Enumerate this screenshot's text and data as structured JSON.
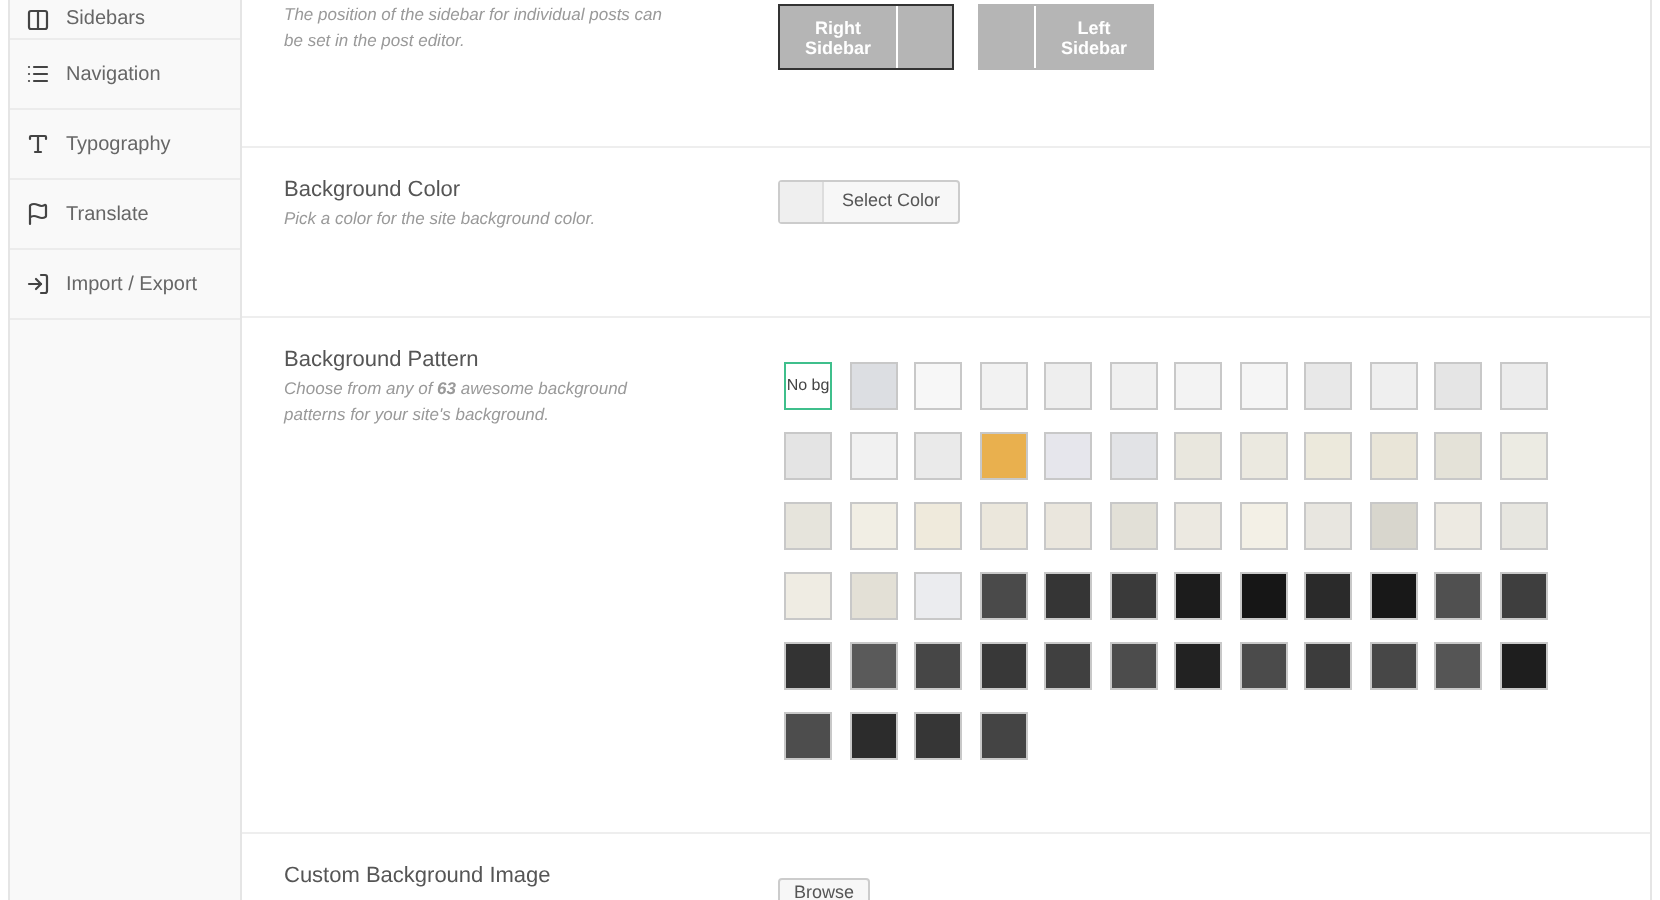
{
  "sidebar": {
    "items": [
      {
        "label": "Sidebars"
      },
      {
        "label": "Navigation"
      },
      {
        "label": "Typography"
      },
      {
        "label": "Translate"
      },
      {
        "label": "Import / Export"
      }
    ]
  },
  "sections": [
    {
      "kind": "layout",
      "description": "The position of the sidebar for individual posts can be set in the post editor.",
      "options": [
        {
          "kind": "right",
          "label": "Right Sidebar",
          "selected": true
        },
        {
          "kind": "left",
          "label": "Left Sidebar",
          "selected": false
        }
      ]
    },
    {
      "kind": "color",
      "title": "Background Color",
      "description": "Pick a color for the site background color.",
      "button": "Select Color"
    },
    {
      "kind": "patterns",
      "title": "Background Pattern",
      "description": "Choose from any of **63** awesome background patterns for your site's background.",
      "patterns": [
        {
          "kind": "none",
          "label": "No bg",
          "selected": true
        },
        {
          "kind": "swatch",
          "color": "#dcdee2",
          "selected": false
        },
        {
          "kind": "swatch",
          "color": "#f7f7f7",
          "selected": false
        },
        {
          "kind": "swatch",
          "color": "#f2f2f2",
          "selected": false
        },
        {
          "kind": "swatch",
          "color": "#eeeeee",
          "selected": false
        },
        {
          "kind": "swatch",
          "color": "#f0f0f0",
          "selected": false
        },
        {
          "kind": "swatch",
          "color": "#f3f3f3",
          "selected": false
        },
        {
          "kind": "swatch",
          "color": "#f5f5f5",
          "selected": false
        },
        {
          "kind": "swatch",
          "color": "#e8e8e8",
          "selected": false
        },
        {
          "kind": "swatch",
          "color": "#efefef",
          "selected": false
        },
        {
          "kind": "swatch",
          "color": "#e5e5e5",
          "selected": false
        },
        {
          "kind": "swatch",
          "color": "#ececec",
          "selected": false
        },
        {
          "kind": "swatch",
          "color": "#e4e4e4",
          "selected": false
        },
        {
          "kind": "swatch",
          "color": "#f1f1f1",
          "selected": false
        },
        {
          "kind": "swatch",
          "color": "#eaeaea",
          "selected": false
        },
        {
          "kind": "swatch",
          "color": "#e9b04e",
          "selected": false
        },
        {
          "kind": "swatch",
          "color": "#e6e6ec",
          "selected": false
        },
        {
          "kind": "swatch",
          "color": "#e2e3e6",
          "selected": false
        },
        {
          "kind": "swatch",
          "color": "#e9e7de",
          "selected": false
        },
        {
          "kind": "swatch",
          "color": "#ebe9e0",
          "selected": false
        },
        {
          "kind": "swatch",
          "color": "#ece9dc",
          "selected": false
        },
        {
          "kind": "swatch",
          "color": "#e9e5d8",
          "selected": false
        },
        {
          "kind": "swatch",
          "color": "#e4e2d8",
          "selected": false
        },
        {
          "kind": "swatch",
          "color": "#ecebe3",
          "selected": false
        },
        {
          "kind": "swatch",
          "color": "#e6e4dc",
          "selected": false
        },
        {
          "kind": "swatch",
          "color": "#f1eee4",
          "selected": false
        },
        {
          "kind": "swatch",
          "color": "#efeadc",
          "selected": false
        },
        {
          "kind": "swatch",
          "color": "#ebe7dc",
          "selected": false
        },
        {
          "kind": "swatch",
          "color": "#eae6dd",
          "selected": false
        },
        {
          "kind": "swatch",
          "color": "#e2e0d7",
          "selected": false
        },
        {
          "kind": "swatch",
          "color": "#ece9e1",
          "selected": false
        },
        {
          "kind": "swatch",
          "color": "#f3f0e6",
          "selected": false
        },
        {
          "kind": "swatch",
          "color": "#e8e6e0",
          "selected": false
        },
        {
          "kind": "swatch",
          "color": "#d8d6cd",
          "selected": false
        },
        {
          "kind": "swatch",
          "color": "#edeae2",
          "selected": false
        },
        {
          "kind": "swatch",
          "color": "#e7e6e0",
          "selected": false
        },
        {
          "kind": "swatch",
          "color": "#efece3",
          "selected": false
        },
        {
          "kind": "swatch",
          "color": "#e3e0d6",
          "selected": false
        },
        {
          "kind": "swatch",
          "color": "#ebecef",
          "selected": false
        },
        {
          "kind": "swatch",
          "color": "#4a4a4a",
          "selected": false
        },
        {
          "kind": "swatch",
          "color": "#353535",
          "selected": false
        },
        {
          "kind": "swatch",
          "color": "#3a3a3a",
          "selected": false
        },
        {
          "kind": "swatch",
          "color": "#1c1c1c",
          "selected": false
        },
        {
          "kind": "swatch",
          "color": "#161616",
          "selected": false
        },
        {
          "kind": "swatch",
          "color": "#2a2a2a",
          "selected": false
        },
        {
          "kind": "swatch",
          "color": "#181818",
          "selected": false
        },
        {
          "kind": "swatch",
          "color": "#505050",
          "selected": false
        },
        {
          "kind": "swatch",
          "color": "#3e3e3e",
          "selected": false
        },
        {
          "kind": "swatch",
          "color": "#333333",
          "selected": false
        },
        {
          "kind": "swatch",
          "color": "#5a5a5a",
          "selected": false
        },
        {
          "kind": "swatch",
          "color": "#464646",
          "selected": false
        },
        {
          "kind": "swatch",
          "color": "#383838",
          "selected": false
        },
        {
          "kind": "swatch",
          "color": "#404040",
          "selected": false
        },
        {
          "kind": "swatch",
          "color": "#4c4c4c",
          "selected": false
        },
        {
          "kind": "swatch",
          "color": "#222222",
          "selected": false
        },
        {
          "kind": "swatch",
          "color": "#4b4b4b",
          "selected": false
        },
        {
          "kind": "swatch",
          "color": "#3c3c3c",
          "selected": false
        },
        {
          "kind": "swatch",
          "color": "#474747",
          "selected": false
        },
        {
          "kind": "swatch",
          "color": "#555555",
          "selected": false
        },
        {
          "kind": "swatch",
          "color": "#1e1e1e",
          "selected": false
        },
        {
          "kind": "swatch",
          "color": "#4d4d4d",
          "selected": false
        },
        {
          "kind": "swatch",
          "color": "#2c2c2c",
          "selected": false
        },
        {
          "kind": "swatch",
          "color": "#363636",
          "selected": false
        },
        {
          "kind": "swatch",
          "color": "#444444",
          "selected": false
        }
      ]
    },
    {
      "kind": "upload",
      "title": "Custom Background Image",
      "button": "Browse"
    }
  ]
}
